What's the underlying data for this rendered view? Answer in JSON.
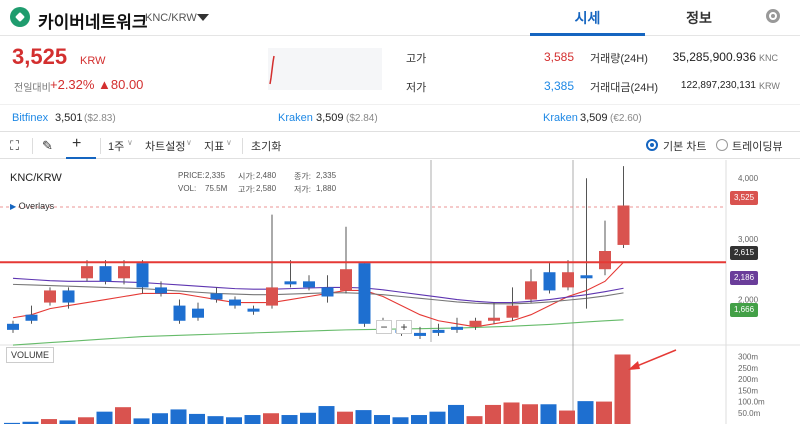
{
  "header": {
    "coin_name": "카이버네트워크",
    "pair": "KNC/KRW",
    "tabs": [
      "시세",
      "정보"
    ],
    "active_tab": "시세",
    "icons": {
      "logo": "kyber-logo",
      "dropdown": "chevron-down-icon",
      "settings": "gear-icon"
    }
  },
  "summary": {
    "price": "3,525",
    "unit": "KRW",
    "change_label": "전일대비",
    "change_pct": "+2.32%",
    "change_amt": "▲80.00",
    "high_label": "고가",
    "high": "3,585",
    "low_label": "저가",
    "low": "3,385",
    "vol_label": "거래량(24H)",
    "vol": "35,285,900.936",
    "vol_unit": "KNC",
    "amt_label": "거래대금(24H)",
    "amt": "122,897,230,131",
    "amt_unit": "KRW",
    "colors": {
      "up": "#d32f2f",
      "down": "#1e88e5"
    }
  },
  "exchanges": [
    {
      "name": "Bitfinex",
      "price": "3,501",
      "ref": "($2.83)"
    },
    {
      "name": "Kraken",
      "price": "3,509",
      "ref": "($2.84)"
    },
    {
      "name": "Kraken",
      "price": "3,509",
      "ref": "(€2.60)"
    }
  ],
  "toolbar": {
    "interval": "1주",
    "chart_settings": "차트설정",
    "indicators": "지표",
    "reset": "초기화",
    "basic_chart": "기본 차트",
    "tradingview": "트레이딩뷰",
    "icons": [
      "fullscreen-icon",
      "pencil-icon",
      "crosshair-icon"
    ]
  },
  "chart": {
    "pair_label": "KNC/KRW",
    "overlays": "Overlays",
    "ohlc": {
      "price_label": "PRICE:",
      "price": "2,335",
      "open_label": "시가:",
      "open": "2,480",
      "close_label": "종가:",
      "close": "2,335",
      "vol_label": "VOL:",
      "vol": "75.5M",
      "high_label": "고가:",
      "high": "2,580",
      "low_label": "저가:",
      "low": "1,880"
    },
    "volume_label": "VOLUME",
    "price_axis": [
      "4,000",
      "3,000",
      "2,000"
    ],
    "volume_axis": [
      "300m",
      "250m",
      "200m",
      "150m",
      "100.0m",
      "50.0m"
    ],
    "tags": [
      {
        "label": "3,525",
        "color": "#d9534f"
      },
      {
        "label": "2,615",
        "color": "#333333"
      },
      {
        "label": "2,186",
        "color": "#6a3d9a"
      },
      {
        "label": "1,666",
        "color": "#43a047"
      }
    ],
    "zoom_out": "−",
    "zoom_in": "+"
  },
  "chart_data": {
    "type": "candlestick",
    "candles": [
      {
        "o": 1600,
        "c": 1500,
        "h": 1650,
        "l": 1450
      },
      {
        "o": 1750,
        "c": 1650,
        "h": 1900,
        "l": 1600
      },
      {
        "o": 1950,
        "c": 2150,
        "h": 2200,
        "l": 1900
      },
      {
        "o": 2150,
        "c": 1950,
        "h": 2200,
        "l": 1850
      },
      {
        "o": 2350,
        "c": 2550,
        "h": 2650,
        "l": 2300
      },
      {
        "o": 2550,
        "c": 2300,
        "h": 2650,
        "l": 2250
      },
      {
        "o": 2350,
        "c": 2550,
        "h": 2650,
        "l": 2250
      },
      {
        "o": 2600,
        "c": 2200,
        "h": 2650,
        "l": 2100
      },
      {
        "o": 2200,
        "c": 2100,
        "h": 2300,
        "l": 2050
      },
      {
        "o": 1900,
        "c": 1650,
        "h": 2000,
        "l": 1600
      },
      {
        "o": 1850,
        "c": 1700,
        "h": 1950,
        "l": 1650
      },
      {
        "o": 2100,
        "c": 2000,
        "h": 2200,
        "l": 1950
      },
      {
        "o": 2000,
        "c": 1900,
        "h": 2050,
        "l": 1850
      },
      {
        "o": 1850,
        "c": 1800,
        "h": 1900,
        "l": 1750
      },
      {
        "o": 1900,
        "c": 2200,
        "h": 3400,
        "l": 1850
      },
      {
        "o": 2300,
        "c": 2250,
        "h": 2650,
        "l": 2200
      },
      {
        "o": 2300,
        "c": 2200,
        "h": 2400,
        "l": 2150
      },
      {
        "o": 2200,
        "c": 2050,
        "h": 2400,
        "l": 1950
      },
      {
        "o": 2150,
        "c": 2500,
        "h": 3200,
        "l": 2100
      },
      {
        "o": 2600,
        "c": 1600,
        "h": 2600,
        "l": 1550
      },
      {
        "o": 1650,
        "c": 1550,
        "h": 1700,
        "l": 1500
      },
      {
        "o": 1500,
        "c": 1450,
        "h": 1550,
        "l": 1400
      },
      {
        "o": 1450,
        "c": 1400,
        "h": 1550,
        "l": 1350
      },
      {
        "o": 1500,
        "c": 1450,
        "h": 1600,
        "l": 1400
      },
      {
        "o": 1550,
        "c": 1500,
        "h": 1700,
        "l": 1450
      },
      {
        "o": 1550,
        "c": 1650,
        "h": 1700,
        "l": 1500
      },
      {
        "o": 1650,
        "c": 1700,
        "h": 1950,
        "l": 1600
      },
      {
        "o": 1700,
        "c": 1900,
        "h": 2200,
        "l": 1650
      },
      {
        "o": 2000,
        "c": 2300,
        "h": 2500,
        "l": 1950
      },
      {
        "o": 2450,
        "c": 2150,
        "h": 2600,
        "l": 2100
      },
      {
        "o": 2200,
        "c": 2450,
        "h": 2650,
        "l": 2150
      },
      {
        "o": 2400,
        "c": 2350,
        "h": 4000,
        "l": 1850
      },
      {
        "o": 2500,
        "c": 2800,
        "h": 3300,
        "l": 2400
      },
      {
        "o": 2900,
        "c": 3550,
        "h": 4200,
        "l": 2850
      }
    ],
    "volumes": [
      5,
      10,
      22,
      16,
      30,
      55,
      75,
      25,
      48,
      65,
      45,
      35,
      30,
      40,
      48,
      40,
      50,
      80,
      55,
      62,
      40,
      30,
      40,
      55,
      85,
      35,
      85,
      96,
      88,
      88,
      60,
      102,
      100,
      310
    ],
    "ylim": [
      1300,
      4300
    ],
    "volume_max": 330,
    "horizontal_line": 2615,
    "last_price": 3525,
    "ma_lines": [
      {
        "name": "MA-red",
        "color": "#e53935",
        "values": [
          1700,
          1750,
          1850,
          1900,
          1950,
          2000,
          2050,
          2100,
          2100,
          2100,
          2050,
          2000,
          1950,
          1950,
          1950,
          2000,
          2050,
          2100,
          2150,
          2150,
          2050,
          1900,
          1750,
          1650,
          1600,
          1550,
          1600,
          1650,
          1750,
          1900,
          2050,
          2150,
          2300,
          2615
        ]
      },
      {
        "name": "MA-purple",
        "color": "#5e35b1",
        "values": [
          2350,
          2330,
          2310,
          2300,
          2300,
          2300,
          2290,
          2280,
          2260,
          2240,
          2220,
          2200,
          2180,
          2170,
          2170,
          2180,
          2190,
          2200,
          2200,
          2190,
          2160,
          2120,
          2080,
          2040,
          2000,
          1970,
          1950,
          1950,
          1970,
          2000,
          2040,
          2080,
          2130,
          2186
        ]
      },
      {
        "name": "MA-gray",
        "color": "#777777",
        "values": [
          2250,
          2240,
          2230,
          2220,
          2210,
          2200,
          2190,
          2180,
          2160,
          2140,
          2120,
          2100,
          2090,
          2080,
          2080,
          2090,
          2100,
          2110,
          2110,
          2100,
          2080,
          2050,
          2020,
          1990,
          1960,
          1940,
          1930,
          1930,
          1940,
          1960,
          1990,
          2020,
          2060,
          2110
        ]
      },
      {
        "name": "MA-green",
        "color": "#66bb6a",
        "values": [
          1250,
          1270,
          1290,
          1310,
          1330,
          1350,
          1370,
          1390,
          1400,
          1410,
          1420,
          1430,
          1440,
          1450,
          1460,
          1470,
          1480,
          1490,
          1500,
          1505,
          1510,
          1515,
          1520,
          1525,
          1530,
          1540,
          1550,
          1560,
          1575,
          1590,
          1610,
          1630,
          1650,
          1666
        ]
      }
    ]
  }
}
